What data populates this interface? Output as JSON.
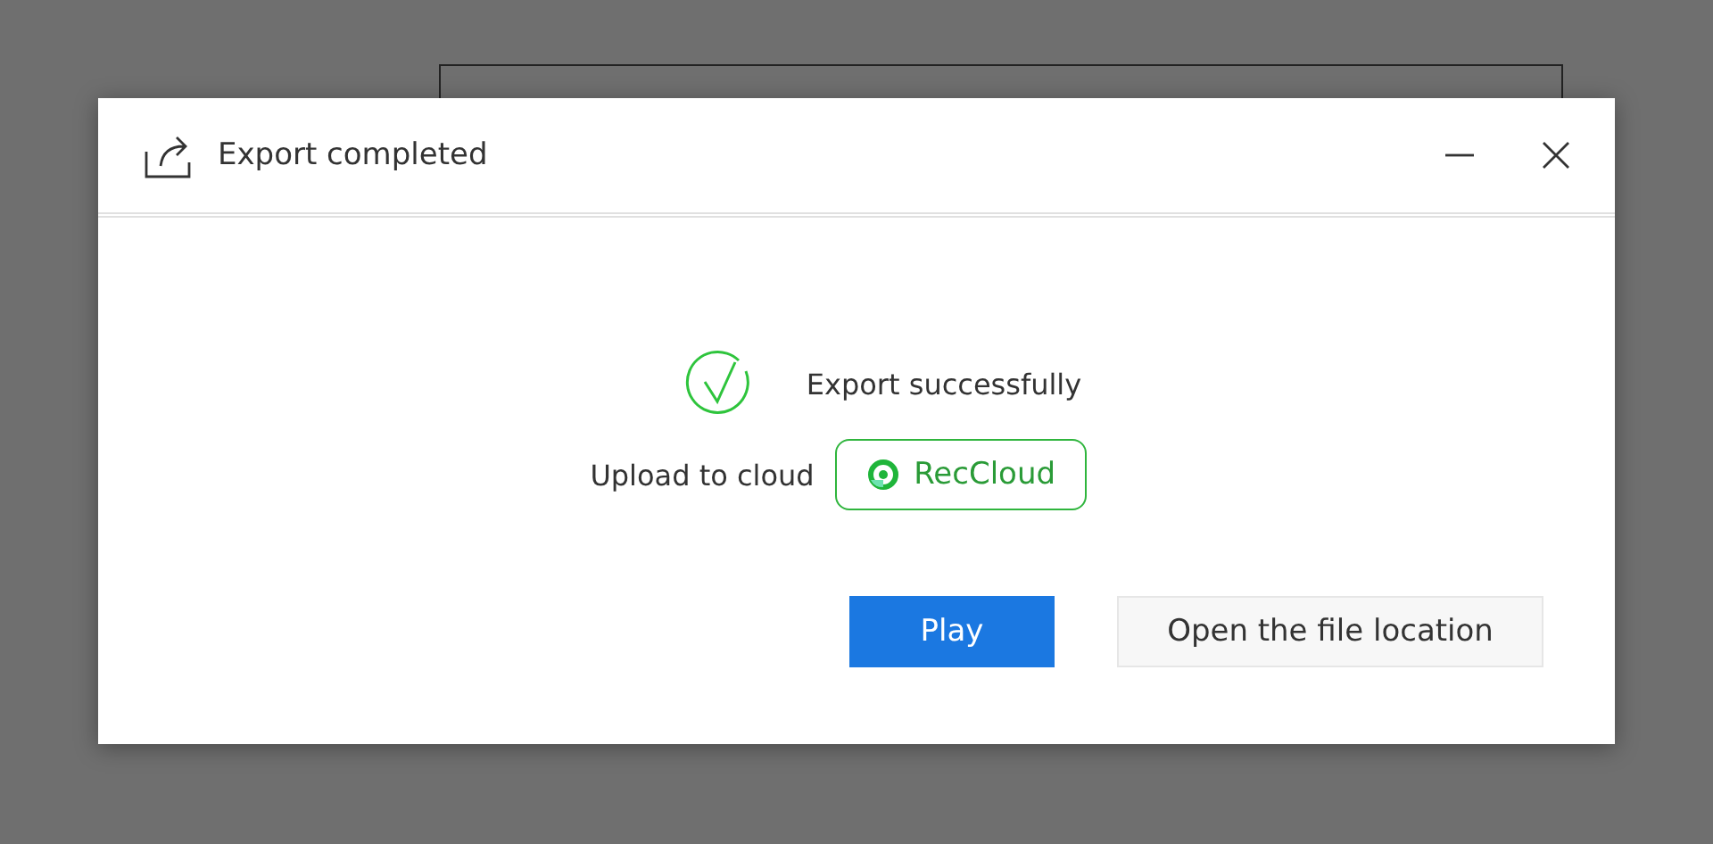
{
  "dialog": {
    "title": "Export completed",
    "status": "Export successfully",
    "upload_label": "Upload to cloud",
    "cloud_button": "RecCloud",
    "buttons": [
      {
        "label": "Play",
        "kind": "primary"
      },
      {
        "label": "Open the file location",
        "kind": "secondary"
      }
    ]
  }
}
